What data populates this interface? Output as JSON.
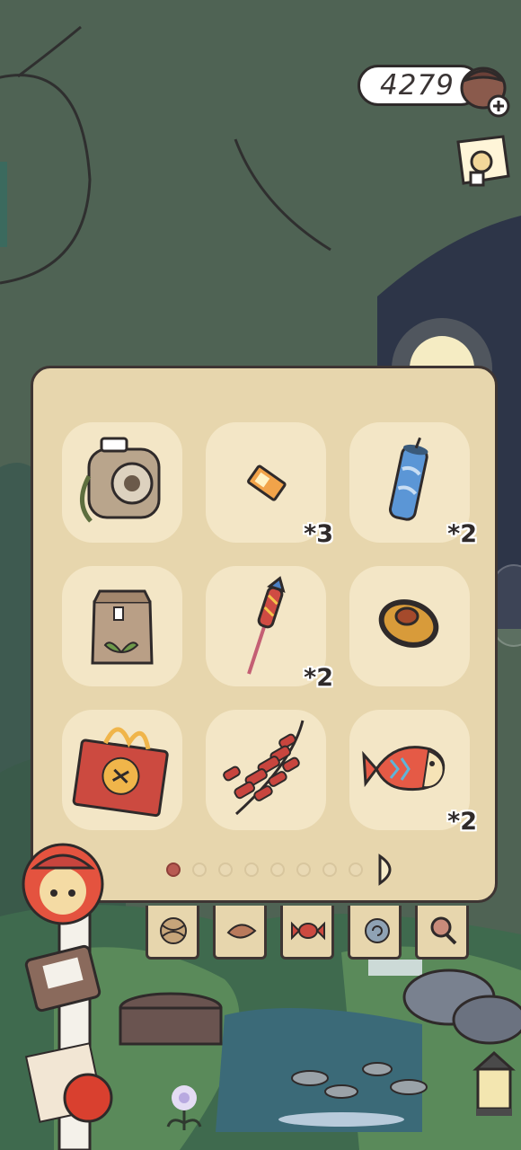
{
  "currency": {
    "amount": "4279",
    "icon": "acorn-icon"
  },
  "inventory": {
    "items": [
      {
        "name": "instant-camera",
        "qty": ""
      },
      {
        "name": "ticket",
        "qty": "*3"
      },
      {
        "name": "firecracker-tube",
        "qty": "*2"
      },
      {
        "name": "paper-bag",
        "qty": ""
      },
      {
        "name": "rocket-firework",
        "qty": "*2"
      },
      {
        "name": "straw-hat",
        "qty": ""
      },
      {
        "name": "gift-bag",
        "qty": ""
      },
      {
        "name": "firecracker-string",
        "qty": ""
      },
      {
        "name": "fish-cake",
        "qty": "*2"
      }
    ],
    "page": 1,
    "page_count": 8
  },
  "tabs": [
    "yarn-icon",
    "leaf-icon",
    "candy-icon",
    "snail-shell-icon",
    "magnifier-icon"
  ],
  "colors": {
    "panel": "#e7d6ad",
    "slot": "#f3e6c6",
    "outline": "#3e3533",
    "active_dot": "#b85a52"
  }
}
